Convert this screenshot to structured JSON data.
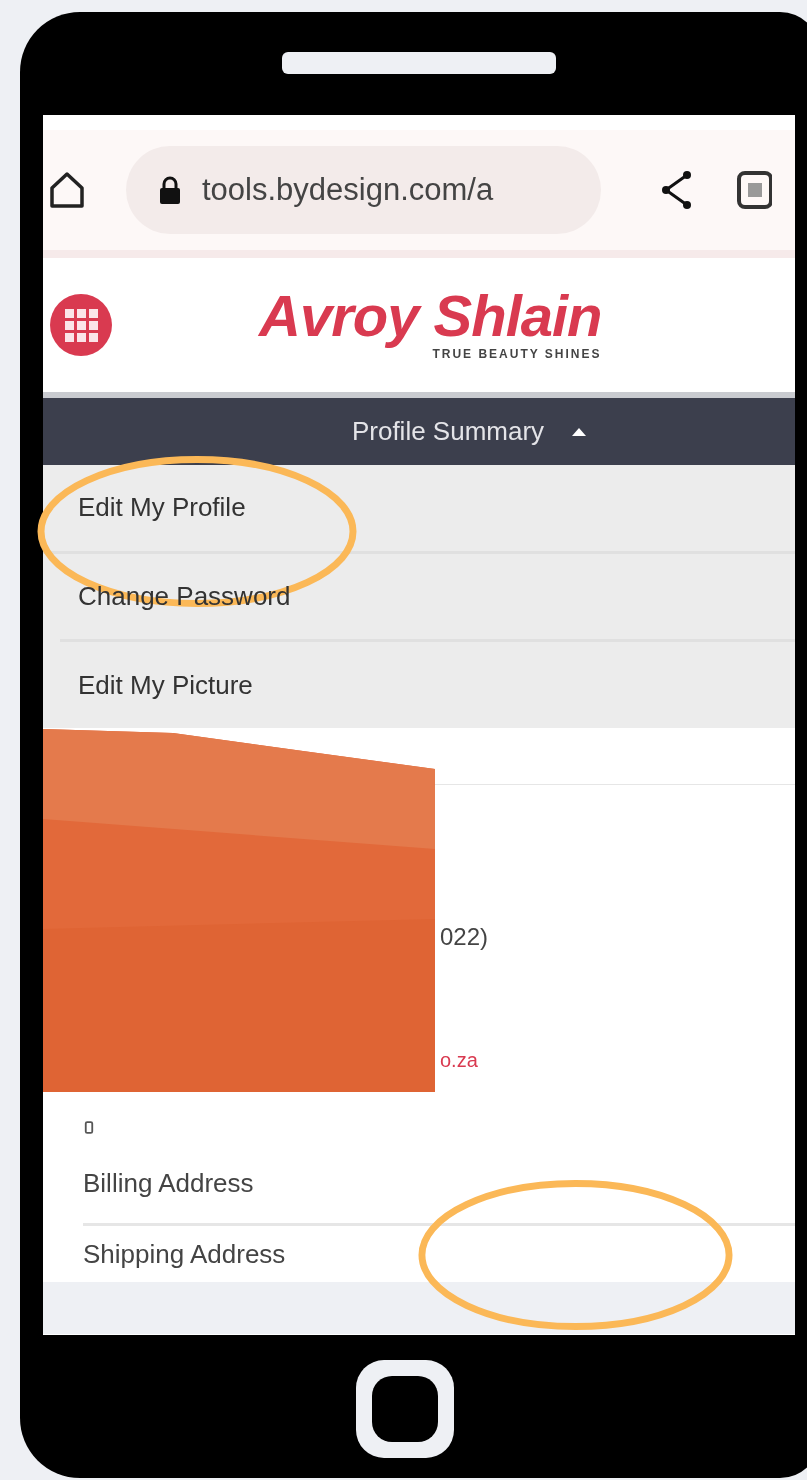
{
  "browser": {
    "url": "tools.bydesign.com/a"
  },
  "logo": {
    "name": "Avroy Shlain",
    "tagline": "TRUE BEAUTY SHINES"
  },
  "section_bar": {
    "title": "Profile Summary",
    "expanded": true
  },
  "menu": [
    {
      "label": "Edit My Profile",
      "circled": true
    },
    {
      "label": "Change Password",
      "circled": false
    },
    {
      "label": "Edit My Picture",
      "circled": false
    }
  ],
  "profile": {
    "redacted": true,
    "fragments": [
      {
        "text": "022)",
        "kind": "plain"
      },
      {
        "text": "o.za",
        "kind": "link"
      }
    ]
  },
  "addresses": [
    {
      "label": "Billing Address",
      "circled": false
    },
    {
      "label": "Shipping Address",
      "circled": true
    }
  ]
}
